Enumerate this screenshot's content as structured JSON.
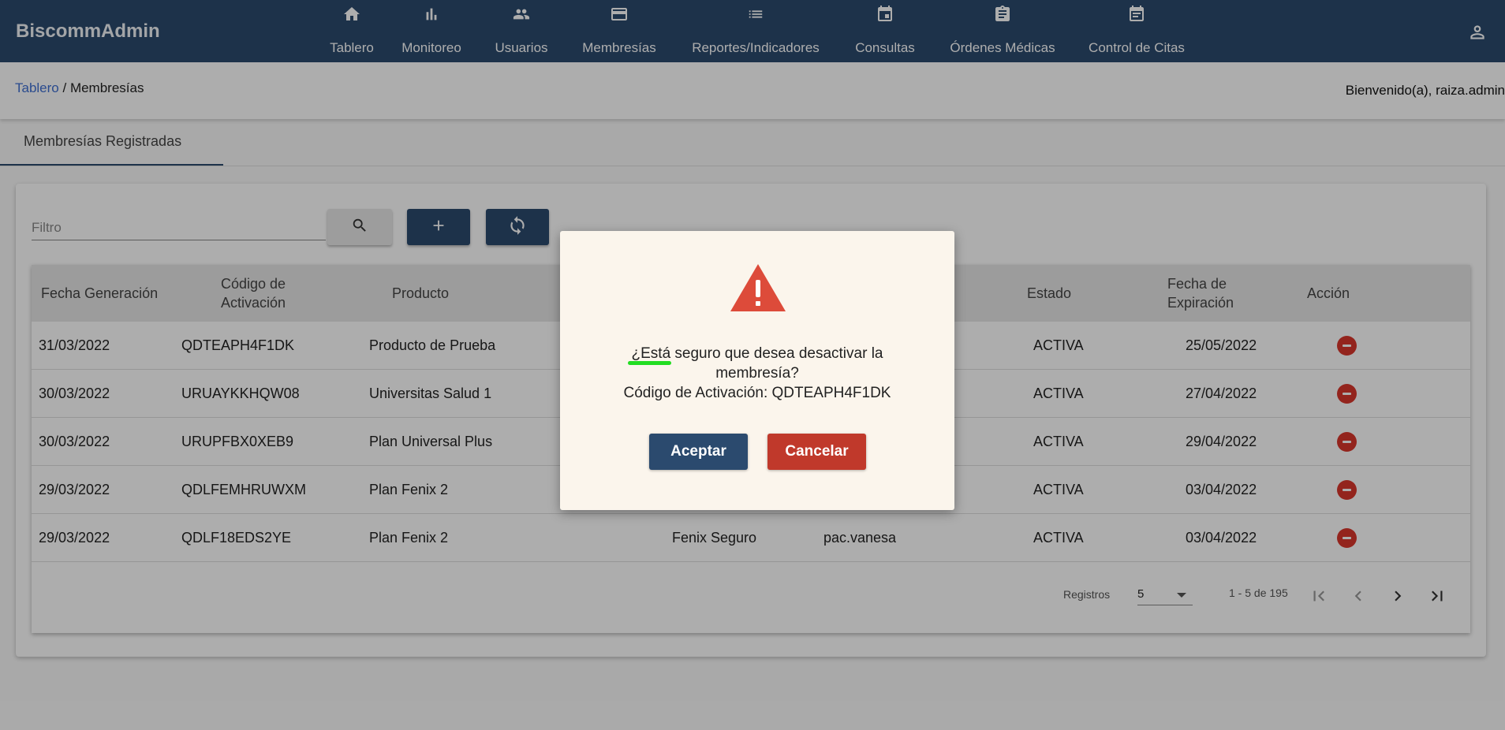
{
  "app": {
    "brand": "BiscommAdmin"
  },
  "nav": [
    {
      "label": "Tablero",
      "icon": "home-icon"
    },
    {
      "label": "Monitoreo",
      "icon": "bar-chart-icon"
    },
    {
      "label": "Usuarios",
      "icon": "people-icon"
    },
    {
      "label": "Membresías",
      "icon": "card-icon"
    },
    {
      "label": "Reportes/Indicadores",
      "icon": "list-icon"
    },
    {
      "label": "Consultas",
      "icon": "calendar-icon"
    },
    {
      "label": "Órdenes Médicas",
      "icon": "clipboard-icon"
    },
    {
      "label": "Control de Citas",
      "icon": "calendar-icon"
    }
  ],
  "breadcrumb": {
    "root": "Tablero",
    "separator": " / ",
    "current": "Membresías"
  },
  "welcome": "Bienvenido(a), raiza.admin",
  "tab": {
    "label": "Membresías Registradas"
  },
  "filter": {
    "placeholder": "Filtro"
  },
  "table": {
    "headers": [
      "Fecha Generación",
      "Código de Activación",
      "Producto",
      "Estado",
      "Fecha de Expiración",
      "Acción"
    ],
    "rows": [
      {
        "fecha": "31/03/2022",
        "codigo": "QDTEAPH4F1DK",
        "producto": "Producto de Prueba",
        "empresa": "",
        "usuario": "",
        "estado": "ACTIVA",
        "expira": "25/05/2022"
      },
      {
        "fecha": "30/03/2022",
        "codigo": "URUAYKKHQW08",
        "producto": "Universitas Salud 1",
        "empresa": "",
        "usuario": "",
        "estado": "ACTIVA",
        "expira": "27/04/2022"
      },
      {
        "fecha": "30/03/2022",
        "codigo": "URUPFBX0XEB9",
        "producto": "Plan Universal Plus",
        "empresa": "",
        "usuario": "",
        "estado": "ACTIVA",
        "expira": "29/04/2022"
      },
      {
        "fecha": "29/03/2022",
        "codigo": "QDLFEMHRUWXM",
        "producto": "Plan Fenix 2",
        "empresa": "",
        "usuario": "",
        "estado": "ACTIVA",
        "expira": "03/04/2022"
      },
      {
        "fecha": "29/03/2022",
        "codigo": "QDLF18EDS2YE",
        "producto": "Plan Fenix 2",
        "empresa": "Fenix Seguro",
        "usuario": "pac.vanesa",
        "estado": "ACTIVA",
        "expira": "03/04/2022"
      }
    ]
  },
  "pager": {
    "label": "Registros",
    "page_size": "5",
    "range": "1 - 5 de 195"
  },
  "dialog": {
    "line1": "¿Está seguro que desea desactivar la",
    "line2": "membresía?",
    "line3": "Código de Activación: QDTEAPH4F1DK",
    "ok": "Aceptar",
    "cancel": "Cancelar"
  },
  "colors": {
    "primary": "#2b4a6e",
    "danger": "#d9362b",
    "link": "#3f6fd1"
  }
}
